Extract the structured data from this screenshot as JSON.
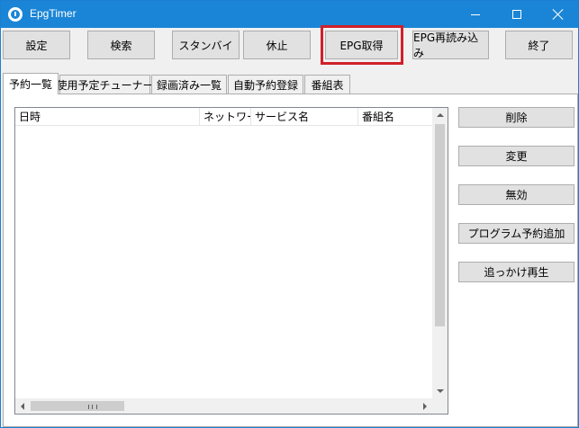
{
  "window": {
    "title": "EpgTimer"
  },
  "toolbar": {
    "buttons": [
      "設定",
      "検索",
      "スタンバイ",
      "休止",
      "EPG取得",
      "EPG再読み込み",
      "終了"
    ]
  },
  "tabs": [
    "予約一覧",
    "使用予定チューナー",
    "録画済み一覧",
    "自動予約登録",
    "番組表"
  ],
  "reservation_list": {
    "columns": [
      "日時",
      "ネットワーク",
      "サービス名",
      "番組名"
    ]
  },
  "side_buttons": [
    "削除",
    "変更",
    "無効",
    "プログラム予約追加",
    "追っかけ再生"
  ],
  "colors": {
    "titlebar": "#1a85d6",
    "highlight": "#d0202a"
  },
  "icons": [
    "clock-icon",
    "minimize-icon",
    "maximize-icon",
    "close-icon",
    "scroll-arrow-icons"
  ]
}
